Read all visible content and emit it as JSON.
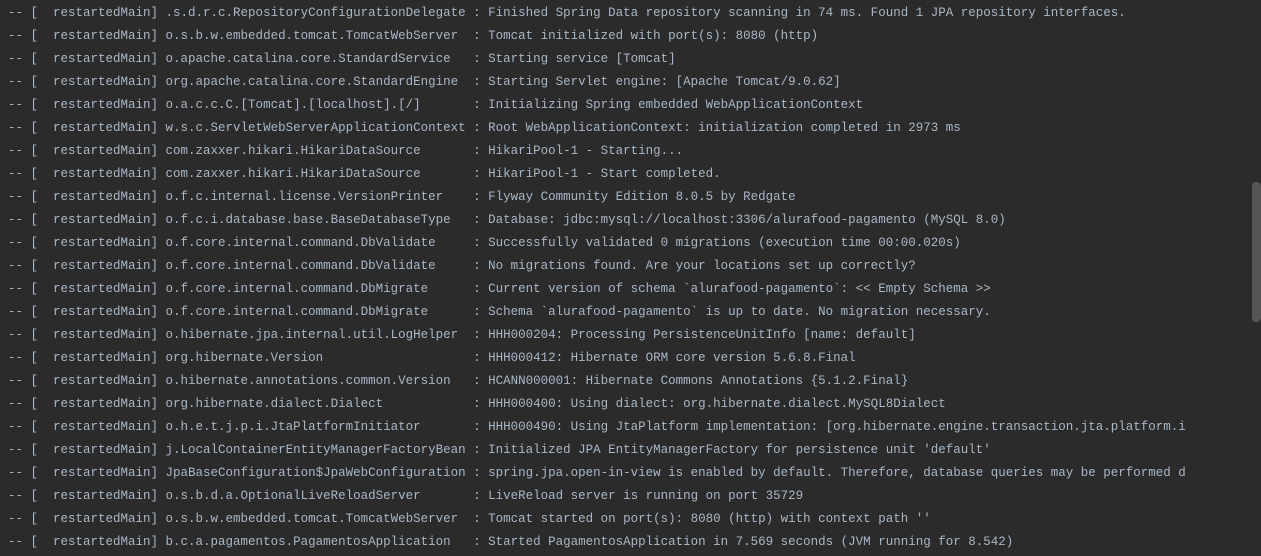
{
  "logs": [
    {
      "prefix": "-- [  ",
      "thread": "restartedMain] ",
      "logger": ".s.d.r.c.RepositoryConfigurationDelegate ",
      "sep": ": ",
      "message": "Finished Spring Data repository scanning in 74 ms. Found 1 JPA repository interfaces."
    },
    {
      "prefix": "-- [  ",
      "thread": "restartedMain] ",
      "logger": "o.s.b.w.embedded.tomcat.TomcatWebServer  ",
      "sep": ": ",
      "message": "Tomcat initialized with port(s): 8080 (http)"
    },
    {
      "prefix": "-- [  ",
      "thread": "restartedMain] ",
      "logger": "o.apache.catalina.core.StandardService   ",
      "sep": ": ",
      "message": "Starting service [Tomcat]"
    },
    {
      "prefix": "-- [  ",
      "thread": "restartedMain] ",
      "logger": "org.apache.catalina.core.StandardEngine  ",
      "sep": ": ",
      "message": "Starting Servlet engine: [Apache Tomcat/9.0.62]"
    },
    {
      "prefix": "-- [  ",
      "thread": "restartedMain] ",
      "logger": "o.a.c.c.C.[Tomcat].[localhost].[/]       ",
      "sep": ": ",
      "message": "Initializing Spring embedded WebApplicationContext"
    },
    {
      "prefix": "-- [  ",
      "thread": "restartedMain] ",
      "logger": "w.s.c.ServletWebServerApplicationContext ",
      "sep": ": ",
      "message": "Root WebApplicationContext: initialization completed in 2973 ms"
    },
    {
      "prefix": "-- [  ",
      "thread": "restartedMain] ",
      "logger": "com.zaxxer.hikari.HikariDataSource       ",
      "sep": ": ",
      "message": "HikariPool-1 - Starting..."
    },
    {
      "prefix": "-- [  ",
      "thread": "restartedMain] ",
      "logger": "com.zaxxer.hikari.HikariDataSource       ",
      "sep": ": ",
      "message": "HikariPool-1 - Start completed."
    },
    {
      "prefix": "-- [  ",
      "thread": "restartedMain] ",
      "logger": "o.f.c.internal.license.VersionPrinter    ",
      "sep": ": ",
      "message": "Flyway Community Edition 8.0.5 by Redgate"
    },
    {
      "prefix": "-- [  ",
      "thread": "restartedMain] ",
      "logger": "o.f.c.i.database.base.BaseDatabaseType   ",
      "sep": ": ",
      "message": "Database: jdbc:mysql://localhost:3306/alurafood-pagamento (MySQL 8.0)"
    },
    {
      "prefix": "-- [  ",
      "thread": "restartedMain] ",
      "logger": "o.f.core.internal.command.DbValidate     ",
      "sep": ": ",
      "message": "Successfully validated 0 migrations (execution time 00:00.020s)"
    },
    {
      "prefix": "-- [  ",
      "thread": "restartedMain] ",
      "logger": "o.f.core.internal.command.DbValidate     ",
      "sep": ": ",
      "message": "No migrations found. Are your locations set up correctly?"
    },
    {
      "prefix": "-- [  ",
      "thread": "restartedMain] ",
      "logger": "o.f.core.internal.command.DbMigrate      ",
      "sep": ": ",
      "message": "Current version of schema `alurafood-pagamento`: << Empty Schema >>"
    },
    {
      "prefix": "-- [  ",
      "thread": "restartedMain] ",
      "logger": "o.f.core.internal.command.DbMigrate      ",
      "sep": ": ",
      "message": "Schema `alurafood-pagamento` is up to date. No migration necessary."
    },
    {
      "prefix": "-- [  ",
      "thread": "restartedMain] ",
      "logger": "o.hibernate.jpa.internal.util.LogHelper  ",
      "sep": ": ",
      "message": "HHH000204: Processing PersistenceUnitInfo [name: default]"
    },
    {
      "prefix": "-- [  ",
      "thread": "restartedMain] ",
      "logger": "org.hibernate.Version                    ",
      "sep": ": ",
      "message": "HHH000412: Hibernate ORM core version 5.6.8.Final"
    },
    {
      "prefix": "-- [  ",
      "thread": "restartedMain] ",
      "logger": "o.hibernate.annotations.common.Version   ",
      "sep": ": ",
      "message": "HCANN000001: Hibernate Commons Annotations {5.1.2.Final}"
    },
    {
      "prefix": "-- [  ",
      "thread": "restartedMain] ",
      "logger": "org.hibernate.dialect.Dialect            ",
      "sep": ": ",
      "message": "HHH000400: Using dialect: org.hibernate.dialect.MySQL8Dialect"
    },
    {
      "prefix": "-- [  ",
      "thread": "restartedMain] ",
      "logger": "o.h.e.t.j.p.i.JtaPlatformInitiator       ",
      "sep": ": ",
      "message": "HHH000490: Using JtaPlatform implementation: [org.hibernate.engine.transaction.jta.platform.i"
    },
    {
      "prefix": "-- [  ",
      "thread": "restartedMain] ",
      "logger": "j.LocalContainerEntityManagerFactoryBean ",
      "sep": ": ",
      "message": "Initialized JPA EntityManagerFactory for persistence unit 'default'"
    },
    {
      "prefix": "-- [  ",
      "thread": "restartedMain] ",
      "logger": "JpaBaseConfiguration$JpaWebConfiguration ",
      "sep": ": ",
      "message": "spring.jpa.open-in-view is enabled by default. Therefore, database queries may be performed d"
    },
    {
      "prefix": "-- [  ",
      "thread": "restartedMain] ",
      "logger": "o.s.b.d.a.OptionalLiveReloadServer       ",
      "sep": ": ",
      "message": "LiveReload server is running on port 35729"
    },
    {
      "prefix": "-- [  ",
      "thread": "restartedMain] ",
      "logger": "o.s.b.w.embedded.tomcat.TomcatWebServer  ",
      "sep": ": ",
      "message": "Tomcat started on port(s): 8080 (http) with context path ''"
    },
    {
      "prefix": "-- [  ",
      "thread": "restartedMain] ",
      "logger": "b.c.a.pagamentos.PagamentosApplication   ",
      "sep": ": ",
      "message": "Started PagamentosApplication in 7.569 seconds (JVM running for 8.542)"
    }
  ]
}
